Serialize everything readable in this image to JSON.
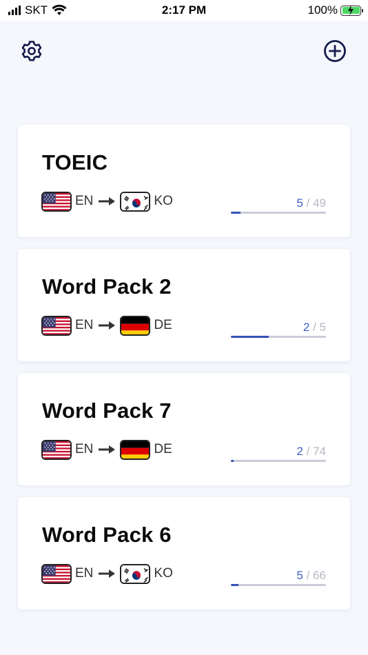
{
  "status_bar": {
    "carrier": "SKT",
    "time": "2:17 PM",
    "battery_percent": "100%"
  },
  "header": {
    "settings_icon": "gear-icon",
    "add_icon": "plus-circle-icon"
  },
  "colors": {
    "accent": "#3552b8",
    "count_done": "#3f5fc4",
    "count_total": "#b5b8c2",
    "background": "#f5f7fd"
  },
  "packs": [
    {
      "title": "TOEIC",
      "from_lang": "EN",
      "to_lang": "KO",
      "learned": "5",
      "separator": "/",
      "total": "49",
      "progress": 0.1
    },
    {
      "title": "Word Pack 2",
      "from_lang": "EN",
      "to_lang": "DE",
      "learned": "2",
      "separator": "/",
      "total": "5",
      "progress": 0.4
    },
    {
      "title": "Word Pack 7",
      "from_lang": "EN",
      "to_lang": "DE",
      "learned": "2",
      "separator": "/",
      "total": "74",
      "progress": 0.03
    },
    {
      "title": "Word Pack 6",
      "from_lang": "EN",
      "to_lang": "KO",
      "learned": "5",
      "separator": "/",
      "total": "66",
      "progress": 0.08
    }
  ]
}
